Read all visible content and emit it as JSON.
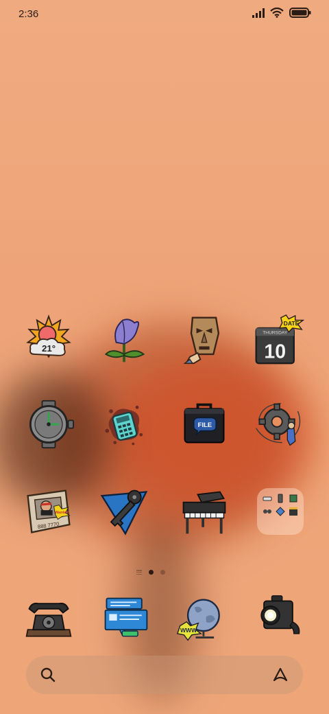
{
  "status_bar": {
    "time": "2:36",
    "icons": [
      "signal-icon",
      "wifi-icon",
      "battery-icon"
    ]
  },
  "home_screen": {
    "rows": [
      [
        {
          "name": "weather-app-icon",
          "badge_text": "21°"
        },
        {
          "name": "flower-app-icon"
        },
        {
          "name": "mask-app-icon"
        },
        {
          "name": "calendar-app-icon",
          "day_text": "THURSDAY",
          "date_number": "10",
          "sticker_text": "DATE"
        }
      ],
      [
        {
          "name": "clock-app-icon"
        },
        {
          "name": "calculator-app-icon"
        },
        {
          "name": "file-manager-app-icon",
          "label_text": "FILE"
        },
        {
          "name": "settings-app-icon"
        }
      ],
      [
        {
          "name": "wanted-poster-app-icon",
          "sticker_text": "Wanted",
          "number_text": "888 7770"
        },
        {
          "name": "key-app-icon"
        },
        {
          "name": "piano-app-icon"
        },
        {
          "name": "app-folder"
        }
      ]
    ],
    "folder_apps": [
      "mini-tool-icon",
      "mini-phone-icon",
      "mini-book-icon",
      "mini-film-icon",
      "mini-mail-icon",
      "mini-clapper-icon"
    ]
  },
  "page_indicator": {
    "pages": 2,
    "current": 1
  },
  "dock": [
    {
      "name": "phone-app-icon"
    },
    {
      "name": "messages-app-icon"
    },
    {
      "name": "browser-app-icon",
      "label_text": "WWW"
    },
    {
      "name": "camera-app-icon"
    }
  ],
  "search_bar": {
    "left_icon": "search-icon",
    "right_icon": "assistant-icon"
  },
  "colors": {
    "wallpaper": "#eea478",
    "flower": "#c4401d",
    "text": "#2a1c14"
  }
}
